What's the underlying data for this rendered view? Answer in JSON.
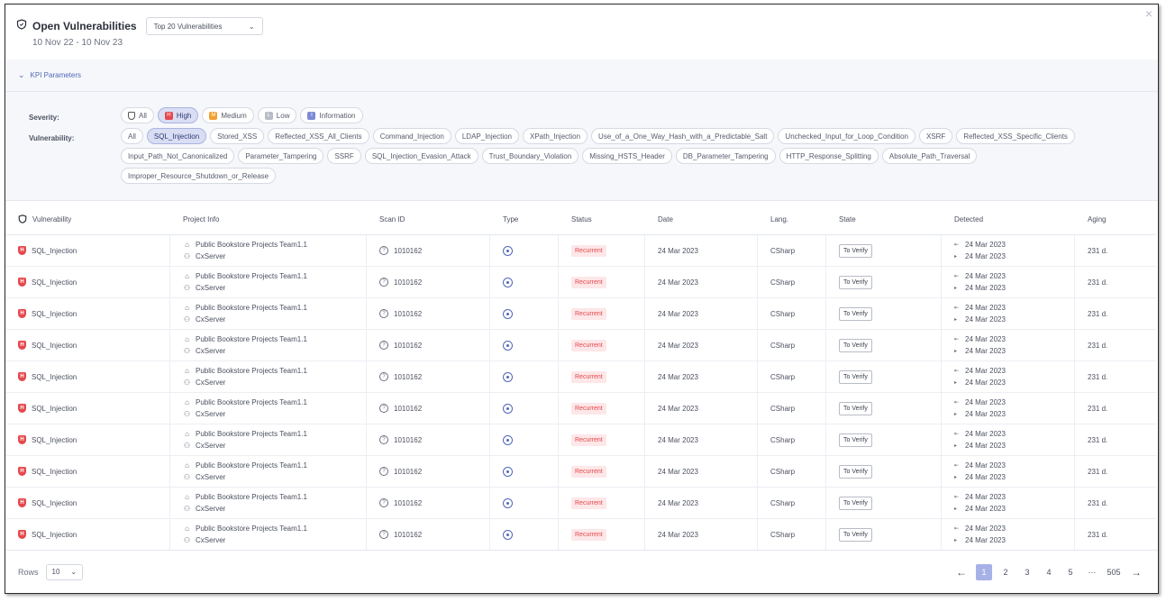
{
  "header": {
    "title": "Open Vulnerabilities",
    "dropdown_value": "Top 20 Vulnerabilities",
    "date_range": "10 Nov 22 - 10 Nov 23"
  },
  "kpi": {
    "label": "KPI Parameters"
  },
  "filters": {
    "severity_label": "Severity:",
    "vulnerability_label": "Vulnerability:",
    "severity": [
      {
        "label": "All",
        "icon": "shield-outline-icon",
        "active": false
      },
      {
        "label": "High",
        "icon": "high-severity-icon",
        "active": true
      },
      {
        "label": "Medium",
        "icon": "medium-severity-icon",
        "active": false
      },
      {
        "label": "Low",
        "icon": "low-severity-icon",
        "active": false
      },
      {
        "label": "Information",
        "icon": "info-severity-icon",
        "active": false
      }
    ],
    "vulnerabilities": [
      {
        "label": "All",
        "active": false
      },
      {
        "label": "SQL_Injection",
        "active": true
      },
      {
        "label": "Stored_XSS",
        "active": false
      },
      {
        "label": "Reflected_XSS_All_Clients",
        "active": false
      },
      {
        "label": "Command_Injection",
        "active": false
      },
      {
        "label": "LDAP_Injection",
        "active": false
      },
      {
        "label": "XPath_Injection",
        "active": false
      },
      {
        "label": "Use_of_a_One_Way_Hash_with_a_Predictable_Salt",
        "active": false
      },
      {
        "label": "Unchecked_Input_for_Loop_Condition",
        "active": false
      },
      {
        "label": "XSRF",
        "active": false
      },
      {
        "label": "Reflected_XSS_Specific_Clients",
        "active": false
      },
      {
        "label": "Input_Path_Not_Canonicalized",
        "active": false
      },
      {
        "label": "Parameter_Tampering",
        "active": false
      },
      {
        "label": "SSRF",
        "active": false
      },
      {
        "label": "SQL_Injection_Evasion_Attack",
        "active": false
      },
      {
        "label": "Trust_Boundary_Violation",
        "active": false
      },
      {
        "label": "Missing_HSTS_Header",
        "active": false
      },
      {
        "label": "DB_Parameter_Tampering",
        "active": false
      },
      {
        "label": "HTTP_Response_Splitting",
        "active": false
      },
      {
        "label": "Absolute_Path_Traversal",
        "active": false
      },
      {
        "label": "Improper_Resource_Shutdown_or_Release",
        "active": false
      }
    ]
  },
  "table": {
    "columns": [
      "Vulnerability",
      "Project Info",
      "Scan ID",
      "Type",
      "Status",
      "Date",
      "Lang.",
      "State",
      "Detected",
      "Aging"
    ],
    "rows": [
      {
        "vulnerability": "SQL_Injection",
        "project": "Public Bookstore Projects Team1.1",
        "server": "CxServer",
        "scan_id": "1010162",
        "status": "Recurrent",
        "date": "24 Mar 2023",
        "lang": "CSharp",
        "state": "To Verify",
        "detected_first": "24 Mar 2023",
        "detected_last": "24 Mar 2023",
        "aging": "231 d."
      },
      {
        "vulnerability": "SQL_Injection",
        "project": "Public Bookstore Projects Team1.1",
        "server": "CxServer",
        "scan_id": "1010162",
        "status": "Recurrent",
        "date": "24 Mar 2023",
        "lang": "CSharp",
        "state": "To Verify",
        "detected_first": "24 Mar 2023",
        "detected_last": "24 Mar 2023",
        "aging": "231 d."
      },
      {
        "vulnerability": "SQL_Injection",
        "project": "Public Bookstore Projects Team1.1",
        "server": "CxServer",
        "scan_id": "1010162",
        "status": "Recurrent",
        "date": "24 Mar 2023",
        "lang": "CSharp",
        "state": "To Verify",
        "detected_first": "24 Mar 2023",
        "detected_last": "24 Mar 2023",
        "aging": "231 d."
      },
      {
        "vulnerability": "SQL_Injection",
        "project": "Public Bookstore Projects Team1.1",
        "server": "CxServer",
        "scan_id": "1010162",
        "status": "Recurrent",
        "date": "24 Mar 2023",
        "lang": "CSharp",
        "state": "To Verify",
        "detected_first": "24 Mar 2023",
        "detected_last": "24 Mar 2023",
        "aging": "231 d."
      },
      {
        "vulnerability": "SQL_Injection",
        "project": "Public Bookstore Projects Team1.1",
        "server": "CxServer",
        "scan_id": "1010162",
        "status": "Recurrent",
        "date": "24 Mar 2023",
        "lang": "CSharp",
        "state": "To Verify",
        "detected_first": "24 Mar 2023",
        "detected_last": "24 Mar 2023",
        "aging": "231 d."
      },
      {
        "vulnerability": "SQL_Injection",
        "project": "Public Bookstore Projects Team1.1",
        "server": "CxServer",
        "scan_id": "1010162",
        "status": "Recurrent",
        "date": "24 Mar 2023",
        "lang": "CSharp",
        "state": "To Verify",
        "detected_first": "24 Mar 2023",
        "detected_last": "24 Mar 2023",
        "aging": "231 d."
      },
      {
        "vulnerability": "SQL_Injection",
        "project": "Public Bookstore Projects Team1.1",
        "server": "CxServer",
        "scan_id": "1010162",
        "status": "Recurrent",
        "date": "24 Mar 2023",
        "lang": "CSharp",
        "state": "To Verify",
        "detected_first": "24 Mar 2023",
        "detected_last": "24 Mar 2023",
        "aging": "231 d."
      },
      {
        "vulnerability": "SQL_Injection",
        "project": "Public Bookstore Projects Team1.1",
        "server": "CxServer",
        "scan_id": "1010162",
        "status": "Recurrent",
        "date": "24 Mar 2023",
        "lang": "CSharp",
        "state": "To Verify",
        "detected_first": "24 Mar 2023",
        "detected_last": "24 Mar 2023",
        "aging": "231 d."
      },
      {
        "vulnerability": "SQL_Injection",
        "project": "Public Bookstore Projects Team1.1",
        "server": "CxServer",
        "scan_id": "1010162",
        "status": "Recurrent",
        "date": "24 Mar 2023",
        "lang": "CSharp",
        "state": "To Verify",
        "detected_first": "24 Mar 2023",
        "detected_last": "24 Mar 2023",
        "aging": "231 d."
      },
      {
        "vulnerability": "SQL_Injection",
        "project": "Public Bookstore Projects Team1.1",
        "server": "CxServer",
        "scan_id": "1010162",
        "status": "Recurrent",
        "date": "24 Mar 2023",
        "lang": "CSharp",
        "state": "To Verify",
        "detected_first": "24 Mar 2023",
        "detected_last": "24 Mar 2023",
        "aging": "231 d."
      }
    ]
  },
  "footer": {
    "rows_label": "Rows",
    "rows_value": "10",
    "pages": [
      "1",
      "2",
      "3",
      "4",
      "5"
    ],
    "current_page": "1",
    "ellipsis": "···",
    "last_page": "505"
  }
}
